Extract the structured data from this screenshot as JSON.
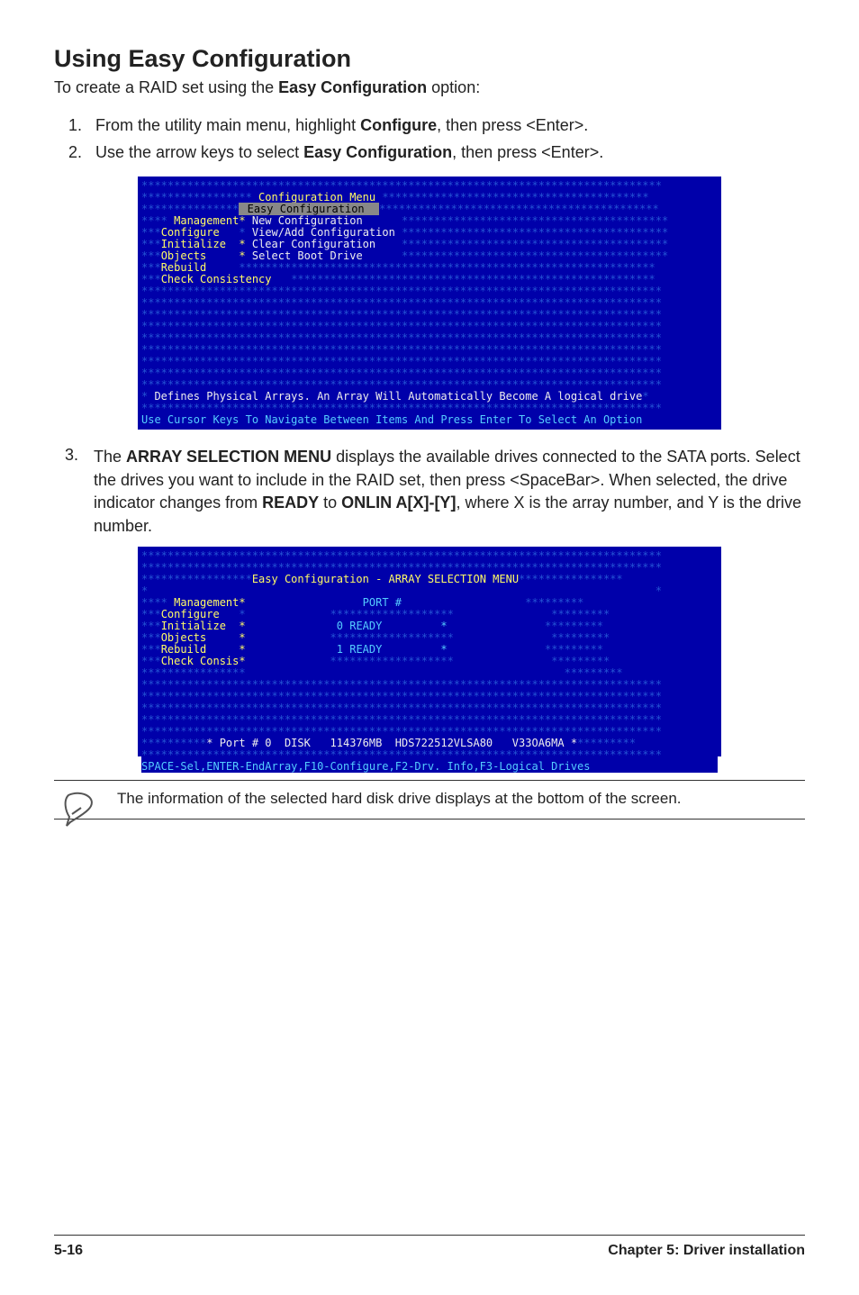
{
  "heading": "Using Easy Configuration",
  "intro_pre": "To create a RAID set using the ",
  "intro_strong": "Easy Configuration",
  "intro_post": " option:",
  "step1_pre": "From the utility main menu, highlight ",
  "step1_b": "Configure",
  "step1_post": ", then press <Enter>.",
  "step2_pre": "Use the arrow keys to select ",
  "step2_b": "Easy Configuration",
  "step2_post": ", then press <Enter>.",
  "bios1": {
    "title": " Configuration Menu ",
    "hi": " Easy Configuration  ",
    "m_management": "Management",
    "o_new": "New Configuration",
    "m_configure": "Configure",
    "o_view": "View/Add Configuration",
    "m_initialize": "Initialize",
    "o_clear": "Clear Configuration",
    "m_objects": "Objects",
    "o_boot": "Select Boot Drive",
    "m_rebuild": "Rebuild",
    "m_check": "Check Consistency",
    "help": " Defines Physical Arrays. An Array Will Automatically Become A logical drive",
    "foot": "Use Cursor Keys To Navigate Between Items And Press Enter To Select An Option"
  },
  "step3_num": "3.",
  "step3_a": "The ",
  "step3_b1": "ARRAY SELECTION MENU",
  "step3_c": " displays the available drives connected to the SATA ports. Select the drives you want to include in the RAID set, then press <SpaceBar>. When selected, the drive indicator changes from ",
  "step3_b2": "READY",
  "step3_d": " to ",
  "step3_b3": "ONLIN A[X]-[Y]",
  "step3_e": ", where X is the array number, and Y is the drive number.",
  "bios2": {
    "title": "Easy Configuration - ARRAY SELECTION MENU",
    "m_management": "Management",
    "m_configure": "Configure",
    "m_initialize": "Initialize",
    "m_objects": "Objects",
    "m_rebuild": "Rebuild",
    "m_check": "Check Consis",
    "port_hdr": "PORT #",
    "row0": "0 READY",
    "row1": "1 READY",
    "info": "Port # 0  DISK   114376MB  HDS722512VLSA80   V33OA6MA",
    "foot": "SPACE-Sel,ENTER-EndArray,F10-Configure,F2-Drv. Info,F3-Logical Drives"
  },
  "note": "The information of the selected hard disk drive displays at the bottom of the screen.",
  "footer_left": "5-16",
  "footer_right": "Chapter 5: Driver installation"
}
